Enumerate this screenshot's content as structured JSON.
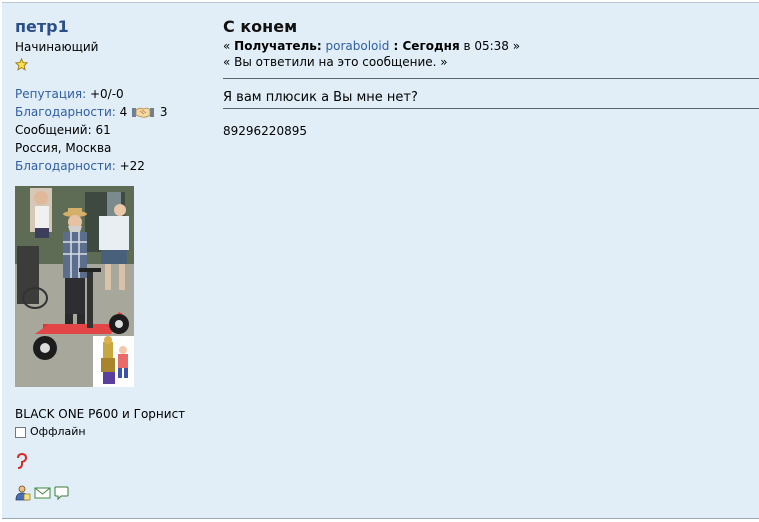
{
  "poster": {
    "name": "петр1",
    "rank": "Начинающий",
    "reputation_label": "Репутация:",
    "reputation_value": " +0/-0",
    "thanks_label": "Благодарности:",
    "thanks_given": " 4",
    "thanks_received": " 3",
    "messages_label": "Сообщений: 61",
    "location": "Россия, Москва",
    "thanks2_label": "Благодарности:",
    "thanks2_value": " +22",
    "signature": "BLACK ONE P600 и Горнист",
    "status": "Оффлайн"
  },
  "message": {
    "subject": "С конем",
    "meta_open": "« ",
    "recipient_label": "Получатель:",
    "recipient": "poraboloid",
    "date_prefix": " : ",
    "date_day": "Сегодня",
    "date_time": " в 05:38 »",
    "replied_note": "« Вы ответили на это сообщение. »",
    "quote": "Я вам плюсик а Вы мне нет?",
    "body": "89296220895"
  },
  "colors": {
    "background": "#e1eef7",
    "link": "#2f5ea6",
    "name": "#2c4e8a"
  },
  "icons": [
    "star-icon",
    "handshake-icon",
    "red-hook-icon",
    "profile-icon",
    "email-icon",
    "message-icon"
  ]
}
